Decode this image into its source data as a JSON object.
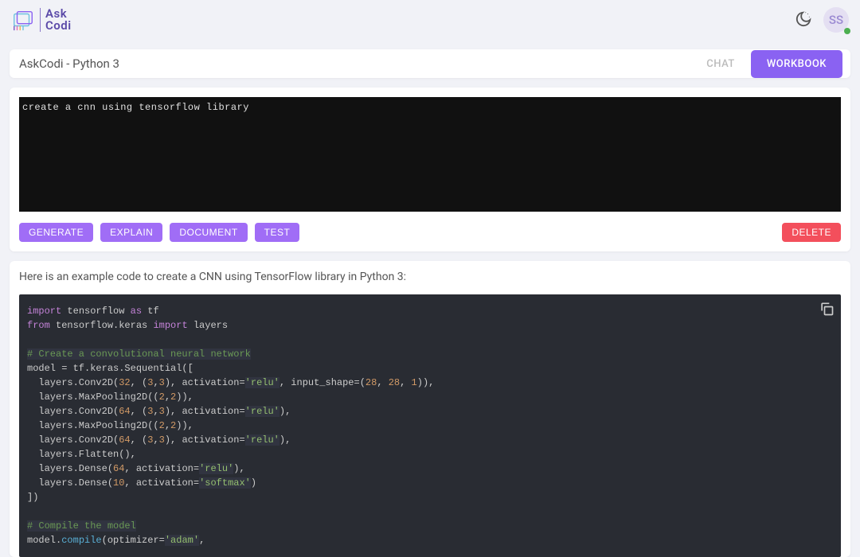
{
  "header": {
    "logo_line1": "Ask",
    "logo_line2": "Codi",
    "avatar_initials": "SS"
  },
  "tabs": {
    "title": "AskCodi - Python 3",
    "chat_label": "CHAT",
    "workbook_label": "WORKBOOK"
  },
  "prompt": {
    "text": "create a cnn using tensorflow library"
  },
  "actions": {
    "generate": "GENERATE",
    "explain": "EXPLAIN",
    "document": "DOCUMENT",
    "test": "TEST",
    "delete": "DELETE"
  },
  "result": {
    "description": "Here is an example code to create a CNN using TensorFlow library in Python 3:"
  },
  "code_lines": {
    "l1a": "import",
    "l1b": " tensorflow ",
    "l1c": "as",
    "l1d": " tf",
    "l2a": "from",
    "l2b": " tensorflow.keras ",
    "l2c": "import",
    "l2d": " layers",
    "l4": "# Create a convolutional neural network",
    "l5": "model = tf.keras.Sequential([",
    "l6a": "  layers.Conv2D(",
    "l6b": "32",
    "l6c": ", (",
    "l6d": "3",
    "l6e": ",",
    "l6f": "3",
    "l6g": "), activation=",
    "l6h": "'relu'",
    "l6i": ", input_shape=(",
    "l6j": "28",
    "l6k": ", ",
    "l6l": "28",
    "l6m": ", ",
    "l6n": "1",
    "l6o": ")),",
    "l7a": "  layers.MaxPooling2D((",
    "l7b": "2",
    "l7c": ",",
    "l7d": "2",
    "l7e": ")),",
    "l8a": "  layers.Conv2D(",
    "l8b": "64",
    "l8c": ", (",
    "l8d": "3",
    "l8e": ",",
    "l8f": "3",
    "l8g": "), activation=",
    "l8h": "'relu'",
    "l8i": "),",
    "l9a": "  layers.MaxPooling2D((",
    "l9b": "2",
    "l9c": ",",
    "l9d": "2",
    "l9e": ")),",
    "l10a": "  layers.Conv2D(",
    "l10b": "64",
    "l10c": ", (",
    "l10d": "3",
    "l10e": ",",
    "l10f": "3",
    "l10g": "), activation=",
    "l10h": "'relu'",
    "l10i": "),",
    "l11": "  layers.Flatten(),",
    "l12a": "  layers.Dense(",
    "l12b": "64",
    "l12c": ", activation=",
    "l12d": "'relu'",
    "l12e": "),",
    "l13a": "  layers.Dense(",
    "l13b": "10",
    "l13c": ", activation=",
    "l13d": "'softmax'",
    "l13e": ")",
    "l14": "])",
    "l16": "# Compile the model",
    "l17a": "model.",
    "l17b": "compile",
    "l17c": "(optimizer=",
    "l17d": "'adam'",
    "l17e": ","
  }
}
